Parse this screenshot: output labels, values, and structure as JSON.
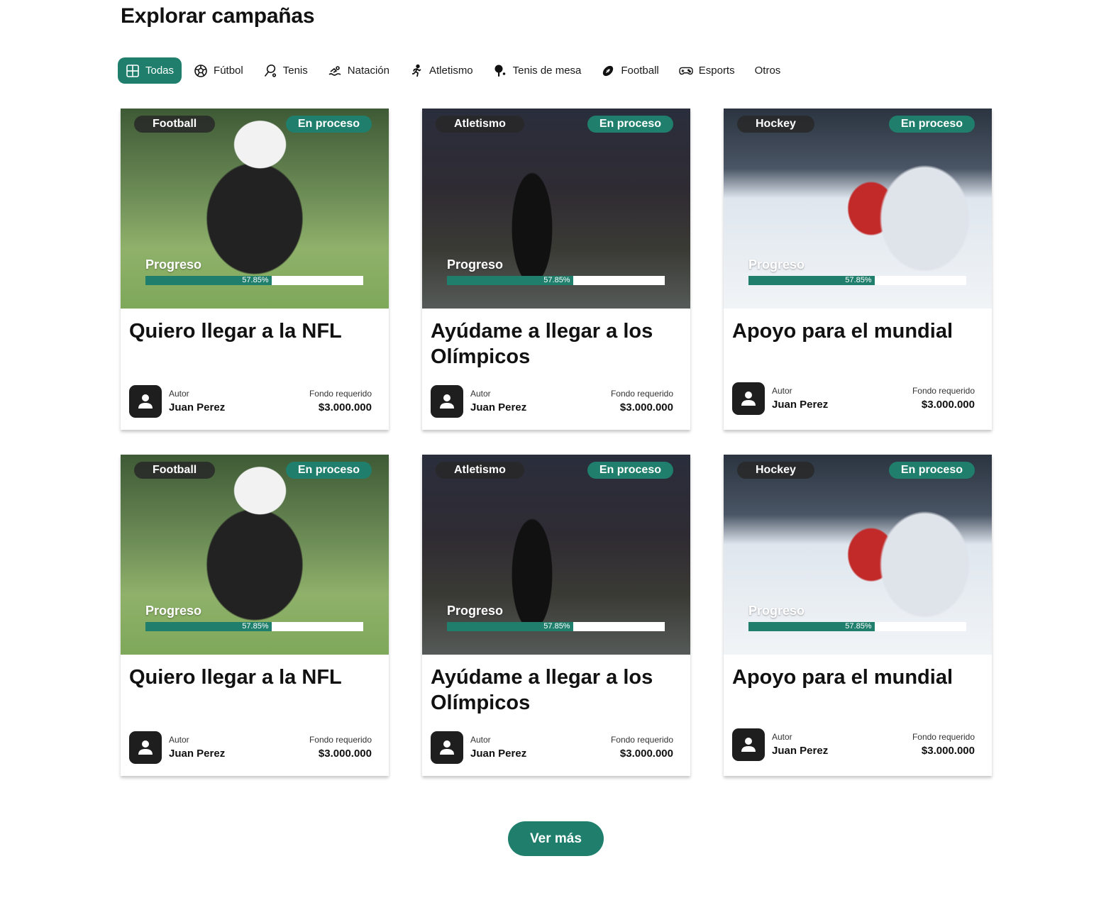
{
  "page": {
    "title": "Explorar campañas"
  },
  "filters": [
    {
      "label": "Todas",
      "icon": "grid-icon",
      "active": true
    },
    {
      "label": "Fútbol",
      "icon": "soccer-ball-icon"
    },
    {
      "label": "Tenis",
      "icon": "tennis-racket-icon"
    },
    {
      "label": "Natación",
      "icon": "swimmer-icon"
    },
    {
      "label": "Atletismo",
      "icon": "runner-icon"
    },
    {
      "label": "Tenis de mesa",
      "icon": "ping-pong-icon"
    },
    {
      "label": "Football",
      "icon": "american-football-icon"
    },
    {
      "label": "Esports",
      "icon": "gamepad-icon"
    },
    {
      "label": "Otros",
      "icon": ""
    }
  ],
  "cards": [
    {
      "sport": "Football",
      "status": "En proceso",
      "progress_label": "Progreso",
      "progress": 57.85,
      "progress_text": "57.85%",
      "title": "Quiero llegar a la NFL",
      "author_label": "Autor",
      "author": "Juan Perez",
      "fund_label": "Fondo requerido",
      "fund": "$3.000.000",
      "image": "football-player-photo"
    },
    {
      "sport": "Atletismo",
      "status": "En proceso",
      "progress_label": "Progreso",
      "progress": 57.85,
      "progress_text": "57.85%",
      "title": "Ayúdame a llegar a los Olímpicos",
      "author_label": "Autor",
      "author": "Juan Perez",
      "fund_label": "Fondo requerido",
      "fund": "$3.000.000",
      "image": "runner-photo"
    },
    {
      "sport": "Hockey",
      "status": "En proceso",
      "progress_label": "Progreso",
      "progress": 57.85,
      "progress_text": "57.85%",
      "title": "Apoyo para el mundial",
      "author_label": "Autor",
      "author": "Juan Perez",
      "fund_label": "Fondo requerido",
      "fund": "$3.000.000",
      "image": "hockey-photo"
    },
    {
      "sport": "Football",
      "status": "En proceso",
      "progress_label": "Progreso",
      "progress": 57.85,
      "progress_text": "57.85%",
      "title": "Quiero llegar a la NFL",
      "author_label": "Autor",
      "author": "Juan Perez",
      "fund_label": "Fondo requerido",
      "fund": "$3.000.000",
      "image": "football-player-photo"
    },
    {
      "sport": "Atletismo",
      "status": "En proceso",
      "progress_label": "Progreso",
      "progress": 57.85,
      "progress_text": "57.85%",
      "title": "Ayúdame a llegar a los Olímpicos",
      "author_label": "Autor",
      "author": "Juan Perez",
      "fund_label": "Fondo requerido",
      "fund": "$3.000.000",
      "image": "runner-photo"
    },
    {
      "sport": "Hockey",
      "status": "En proceso",
      "progress_label": "Progreso",
      "progress": 57.85,
      "progress_text": "57.85%",
      "title": "Apoyo para el mundial",
      "author_label": "Autor",
      "author": "Juan Perez",
      "fund_label": "Fondo requerido",
      "fund": "$3.000.000",
      "image": "hockey-photo"
    }
  ],
  "more_button": {
    "label": "Ver más"
  },
  "colors": {
    "accent": "#1f7f6c",
    "dark_tag": "#282828",
    "avatar": "#1e1e1e"
  }
}
